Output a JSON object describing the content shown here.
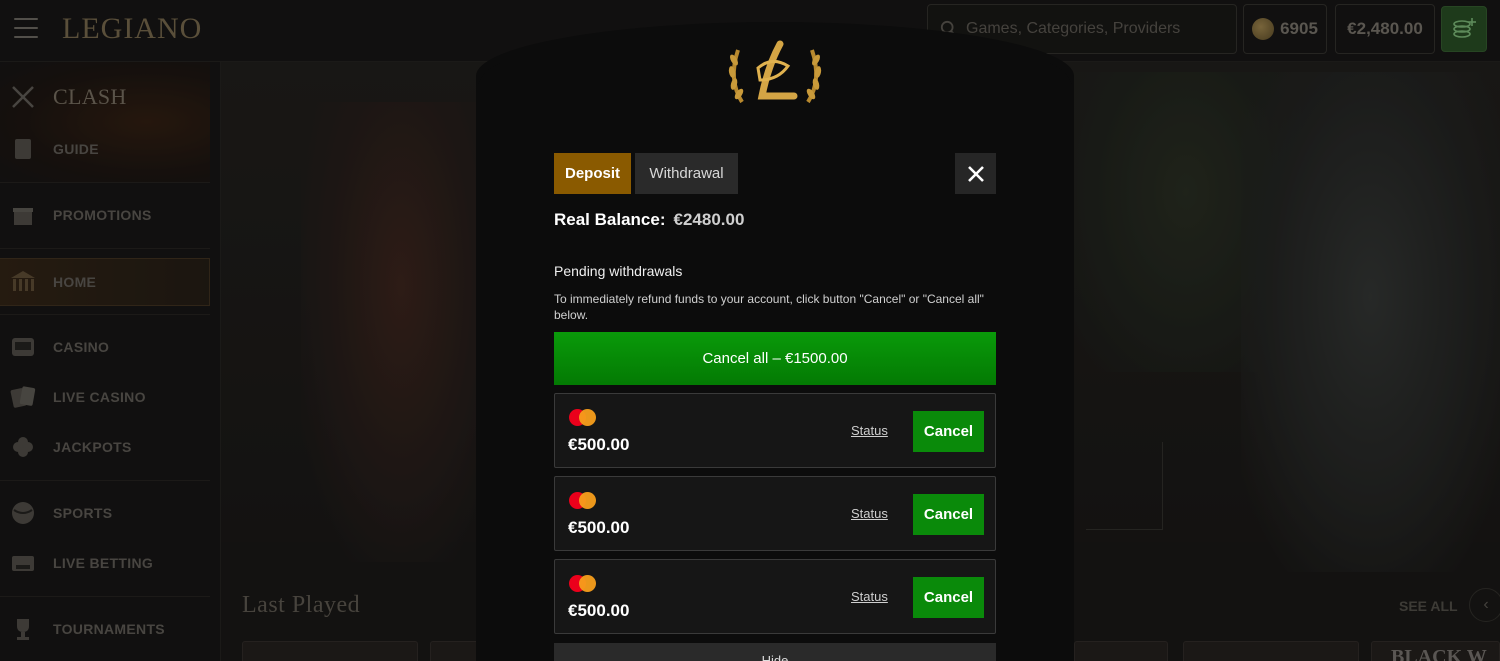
{
  "header": {
    "logo": "LEGIANO",
    "search_placeholder": "Games, Categories, Providers",
    "coins": "6905",
    "balance": "€2,480.00"
  },
  "sidebar": {
    "items": [
      {
        "label": "CLASH",
        "icon": "crossed-swords-icon"
      },
      {
        "label": "GUIDE",
        "icon": "scroll-icon"
      },
      {
        "label": "PROMOTIONS",
        "icon": "gift-icon"
      },
      {
        "label": "HOME",
        "icon": "temple-icon"
      },
      {
        "label": "CASINO",
        "icon": "slot-machine-icon"
      },
      {
        "label": "LIVE CASINO",
        "icon": "cards-icon"
      },
      {
        "label": "JACKPOTS",
        "icon": "clover-icon"
      },
      {
        "label": "SPORTS",
        "icon": "ball-icon"
      },
      {
        "label": "LIVE BETTING",
        "icon": "live-tv-icon"
      },
      {
        "label": "TOURNAMENTS",
        "icon": "trophy-icon"
      }
    ]
  },
  "main": {
    "last_played_title": "Last Played",
    "see_all": "SEE ALL",
    "thumb_text": "BLACK W"
  },
  "modal": {
    "tabs": [
      "Deposit",
      "Withdrawal"
    ],
    "active_tab": "Deposit",
    "real_balance_label": "Real Balance:",
    "real_balance_value": "€2480.00",
    "pending_title": "Pending withdrawals",
    "pending_desc": "To immediately refund funds to your account, click button \"Cancel\" or \"Cancel all\" below.",
    "cancel_all_label": "Cancel all – €1500.00",
    "withdrawals": [
      {
        "amount": "€500.00",
        "status": "Status",
        "cancel": "Cancel",
        "method": "mastercard-icon"
      },
      {
        "amount": "€500.00",
        "status": "Status",
        "cancel": "Cancel",
        "method": "mastercard-icon"
      },
      {
        "amount": "€500.00",
        "status": "Status",
        "cancel": "Cancel",
        "method": "mastercard-icon"
      }
    ],
    "hide_label": "Hide"
  },
  "colors": {
    "deposit_tab": "#8a5a00",
    "cancel_green": "#0a8a0a",
    "modal_bg": "#0c0c0c"
  }
}
